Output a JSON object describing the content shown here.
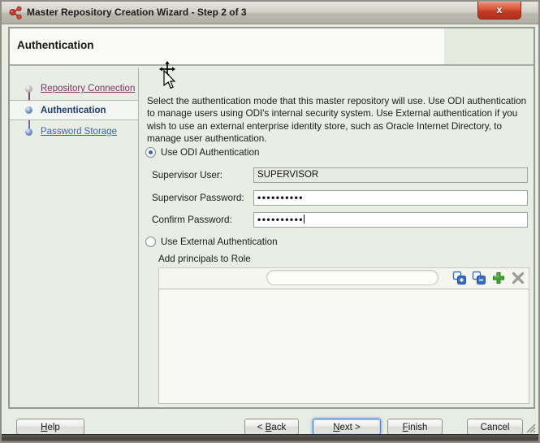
{
  "window": {
    "title": "Master Repository Creation Wizard - Step 2 of 3",
    "close_glyph": "x"
  },
  "header": {
    "title": "Authentication"
  },
  "sidebar": {
    "steps": [
      {
        "label": "Repository Connection",
        "state": "visited"
      },
      {
        "label": "Authentication",
        "state": "current"
      },
      {
        "label": "Password Storage",
        "state": "pending"
      }
    ]
  },
  "content": {
    "description": "Select the authentication mode that this master repository will use. Use ODI authentication to manage users using ODI's internal security system. Use External authentication if you wish to use an external enterprise identity store, such as Oracle Internet Directory, to manage user authentication.",
    "radios": {
      "odi": {
        "label": "Use ODI Authentication",
        "selected": true
      },
      "external": {
        "label": "Use External Authentication",
        "selected": false
      }
    },
    "fields": {
      "supervisor_user": {
        "label": "Supervisor User:",
        "value": "SUPERVISOR"
      },
      "supervisor_password": {
        "label": "Supervisor Password:",
        "value": "••••••••••"
      },
      "confirm_password": {
        "label": "Confirm Password:",
        "value": "••••••••••"
      }
    },
    "principals": {
      "label": "Add principals to Role",
      "search": {
        "value": "",
        "placeholder": ""
      },
      "toolbar_icons": [
        "add-all-icon",
        "remove-all-icon",
        "add-icon",
        "delete-icon"
      ]
    }
  },
  "footer": {
    "help": {
      "text": "Help",
      "mnemonic": "H"
    },
    "back": {
      "text": "< Back",
      "mnemonic": "B"
    },
    "next": {
      "text": "Next >",
      "mnemonic": "N"
    },
    "finish": {
      "text": "Finish",
      "mnemonic": "F"
    },
    "cancel": {
      "text": "Cancel",
      "mnemonic": ""
    }
  },
  "colors": {
    "accent_blue": "#3a6cc8",
    "add_green": "#43a531",
    "delete_gray": "#9b9b97",
    "link_visited": "#7d3164",
    "link_pending": "#3c63a8",
    "current_step_text": "#1e3a75",
    "close_red": "#c23a24"
  }
}
